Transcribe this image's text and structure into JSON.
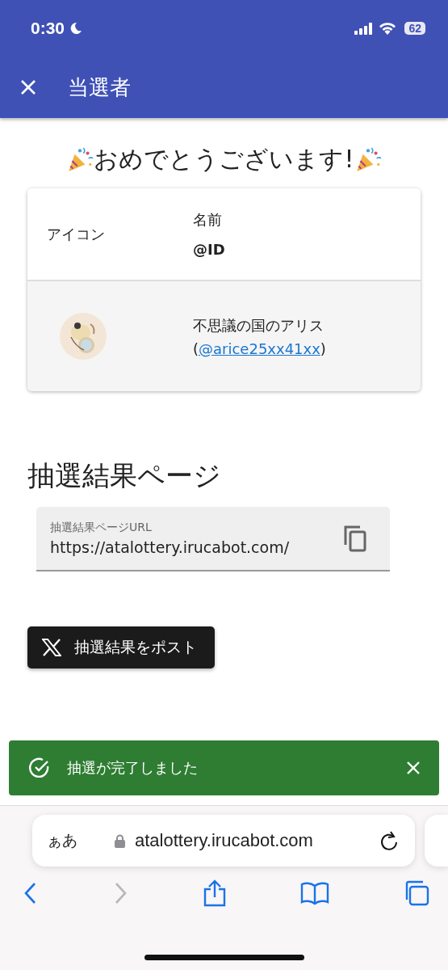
{
  "status_bar": {
    "time": "0:30",
    "battery": "62"
  },
  "app_bar": {
    "title": "当選者"
  },
  "headline": "おめでとうございます!",
  "winners_table": {
    "columns": [
      {
        "label": "アイコン"
      },
      {
        "label": "名前",
        "sublabel": "@ID"
      }
    ],
    "rows": [
      {
        "name": "不思議の国のアリス",
        "open": "(",
        "handle": "@arice25xx41xx",
        "close": ")"
      }
    ]
  },
  "results_section": {
    "heading": "抽選結果ページ",
    "url_field": {
      "label": "抽選結果ページURL",
      "value": "https://atalottery.irucabot.com/"
    }
  },
  "post_button": {
    "label": "抽選結果をポスト"
  },
  "snackbar": {
    "message": "抽選が完了しました"
  },
  "browser": {
    "text_size": "ぁあ",
    "address": "atalottery.irucabot.com",
    "toolbar": [
      {
        "kind": "back",
        "disabled": false
      },
      {
        "kind": "forward",
        "disabled": true
      },
      {
        "kind": "share",
        "disabled": false
      },
      {
        "kind": "bookmarks",
        "disabled": false
      },
      {
        "kind": "tabs",
        "disabled": false
      }
    ]
  }
}
